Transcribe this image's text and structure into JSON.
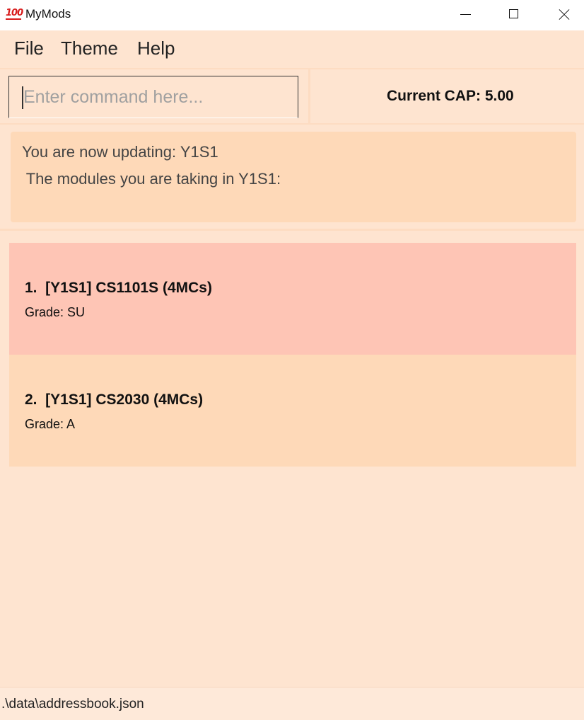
{
  "window": {
    "title": "MyMods",
    "icon": "100-icon",
    "icon_text": "100"
  },
  "menu": {
    "items": [
      {
        "label": "File"
      },
      {
        "label": "Theme"
      },
      {
        "label": "Help"
      }
    ]
  },
  "command": {
    "placeholder": "Enter command here...",
    "value": ""
  },
  "cap": {
    "label": "Current CAP: 5.00"
  },
  "result": {
    "line1": "You are now updating: Y1S1",
    "line2": " The modules you are taking in Y1S1:"
  },
  "modules": [
    {
      "title": "1.  [Y1S1] CS1101S (4MCs)",
      "grade": "Grade: SU"
    },
    {
      "title": "2.  [Y1S1] CS2030 (4MCs)",
      "grade": "Grade: A"
    }
  ],
  "status": {
    "path": ".\\data\\addressbook.json"
  },
  "colors": {
    "background": "#fee4d0",
    "card_highlight": "#fec5b5",
    "card_normal": "#fed9b8",
    "status_bar": "#fee9d9"
  }
}
